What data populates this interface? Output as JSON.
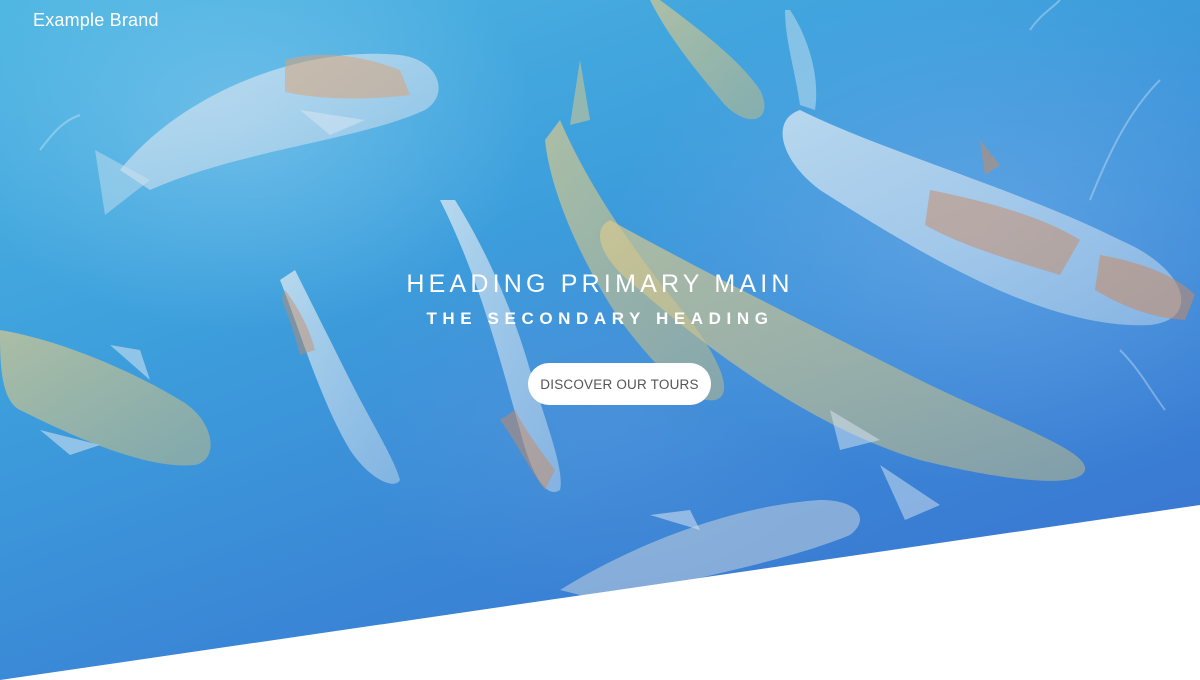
{
  "navbar": {
    "brand": "Example Brand"
  },
  "hero": {
    "heading_primary": "HEADING PRIMARY MAIN",
    "heading_secondary": "THE SECONDARY HEADING",
    "cta_label": "DISCOVER OUR TOURS",
    "background_image": "koi-fish-pond-icon",
    "overlay_color": "#3a8fd8",
    "bottom_color": "#ffffff"
  }
}
